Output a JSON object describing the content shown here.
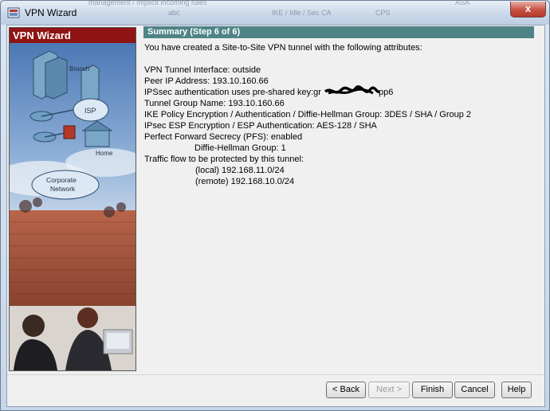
{
  "window": {
    "title": "VPN Wizard",
    "close_glyph": "x",
    "background_tabs": [
      "management / Implicit incoming rules",
      "abc",
      "IKE / Idle / Sec CA",
      "CPS",
      "ASA"
    ]
  },
  "left_panel": {
    "header": "VPN Wizard",
    "diagram_labels": {
      "branch": "Branch",
      "isp": "ISP",
      "home": "Home",
      "corporate": "Corporate",
      "network": "Network"
    }
  },
  "summary": {
    "header": "Summary  (Step 6 of 6)",
    "intro": "You have created a Site-to-Site VPN tunnel with the following attributes:",
    "tunnel_interface": "VPN Tunnel Interface:  outside",
    "peer_ip": "Peer IP Address:  193.10.160.66",
    "psk_prefix": "IPSsec authentication uses pre-shared key:gr",
    "psk_suffix": "pp6",
    "tunnel_group": "Tunnel Group Name:  193.10.160.66",
    "ike_policy": "IKE Policy Encryption / Authentication / Diffie-Hellman Group:  3DES / SHA / Group 2",
    "esp": "IPsec ESP Encryption / ESP Authentication:  AES-128 / SHA",
    "pfs": "Perfect Forward Secrecy (PFS): enabled",
    "dh_group": "Diffie-Hellman Group:  1",
    "traffic": "Traffic flow to be protected by this tunnel:",
    "local": "(local)  192.168.11.0/24",
    "remote": "(remote)  192.168.10.0/24"
  },
  "buttons": {
    "back": "< Back",
    "next": "Next >",
    "finish": "Finish",
    "cancel": "Cancel",
    "help": "Help"
  },
  "colors": {
    "left_header_bg": "#8f1414",
    "summary_header_bg": "#4e8486",
    "close_button": "#c75040"
  }
}
